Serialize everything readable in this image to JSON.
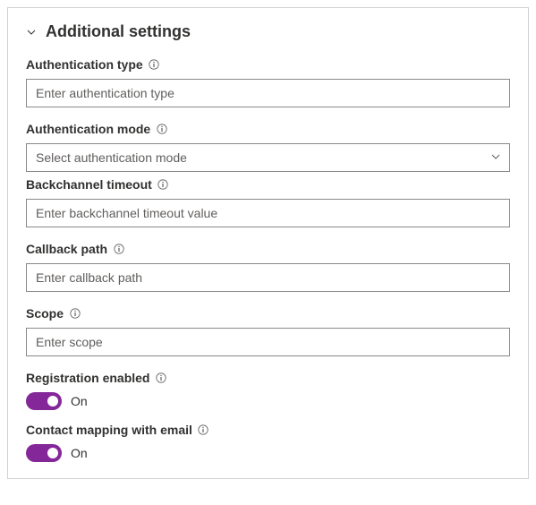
{
  "section": {
    "title": "Additional settings"
  },
  "fields": {
    "auth_type": {
      "label": "Authentication type",
      "placeholder": "Enter authentication type"
    },
    "auth_mode": {
      "label": "Authentication mode",
      "placeholder": "Select authentication mode"
    },
    "backchannel": {
      "label": "Backchannel timeout",
      "placeholder": "Enter backchannel timeout value"
    },
    "callback": {
      "label": "Callback path",
      "placeholder": "Enter callback path"
    },
    "scope": {
      "label": "Scope",
      "placeholder": "Enter scope"
    },
    "registration": {
      "label": "Registration enabled",
      "state_label": "On"
    },
    "contact_mapping": {
      "label": "Contact mapping with email",
      "state_label": "On"
    }
  }
}
